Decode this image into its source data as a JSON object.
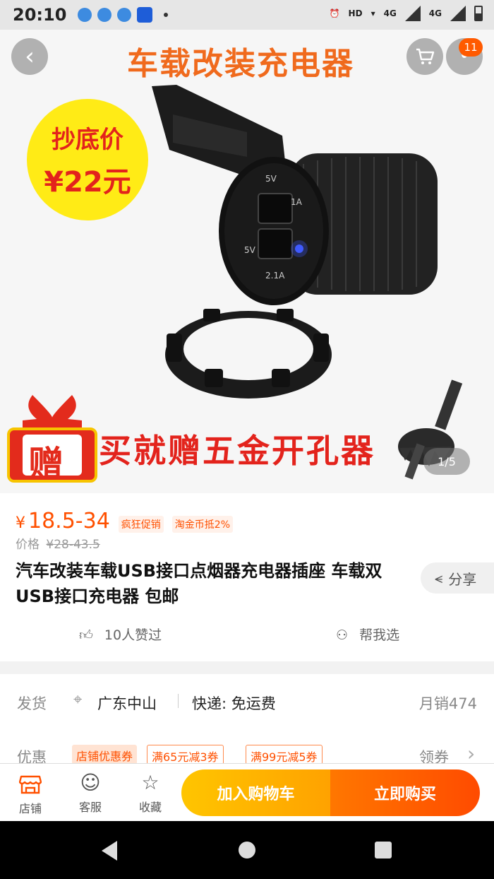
{
  "status_bar": {
    "time": "20:10",
    "network1": "4G",
    "network2": "4G",
    "hd": "HD"
  },
  "hero": {
    "title": "车载改装充电器",
    "promo_line1": "抄底价",
    "promo_line2": "¥22元",
    "gift_char": "赠",
    "gift_text": "买就赠五金开孔器",
    "image_counter": "1/5",
    "cart_badge": "11",
    "usb_labels": [
      "5V",
      "1A",
      "5V",
      "2.1A"
    ]
  },
  "price": {
    "currency": "¥",
    "range": "18.5-34",
    "tags": [
      "疯狂促销",
      "淘金币抵2%"
    ],
    "old_label": "价格",
    "old_range": "¥28-43.5"
  },
  "product": {
    "title": "汽车改装车载USB接口点烟器充电器插座 车载双USB接口充电器 包邮",
    "share_label": "分享",
    "likes": "10人赞过",
    "help_choose": "帮我选"
  },
  "shipping": {
    "label": "发货",
    "location": "广东中山",
    "express": "快递: 免运费",
    "monthly_sales": "月销474"
  },
  "coupons": {
    "label": "优惠",
    "items": [
      "店铺优惠券",
      "满65元减3券",
      "满99元减5券"
    ],
    "get_label": "领券"
  },
  "actions": {
    "shop": "店铺",
    "service": "客服",
    "favorite": "收藏",
    "add_to_cart": "加入购物车",
    "buy_now": "立即购买"
  },
  "icons": {
    "back": "back-icon",
    "cart": "cart-icon",
    "more": "more-icon",
    "share": "share-icon",
    "thumbs_up": "thumbs-up-icon",
    "group": "people-icon",
    "location": "location-icon",
    "chevron": "chevron-right-icon",
    "shop": "shop-icon",
    "service": "service-icon",
    "star": "star-icon"
  },
  "colors": {
    "accent": "#ff5000",
    "cart_button": "#ffb300",
    "buy_button": "#ff5a00",
    "promo_yellow": "#ffeb16"
  }
}
